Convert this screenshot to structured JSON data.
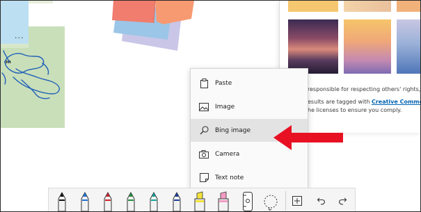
{
  "canvas": {
    "blue_note": {
      "ellipsis": "..."
    },
    "green_note": {
      "partial_text": "on"
    }
  },
  "panel": {
    "legal_line_1": "responsible for respecting others' rights, inc",
    "legal_line_2_prefix": "esults are tagged with ",
    "legal_link": "Creative Commons li",
    "legal_line_3": "he licenses to ensure you comply."
  },
  "context_menu": {
    "items": [
      {
        "label": "Paste",
        "icon": "paste-icon"
      },
      {
        "label": "Image",
        "icon": "image-icon"
      },
      {
        "label": "Bing image",
        "icon": "search-icon",
        "selected": true
      },
      {
        "label": "Camera",
        "icon": "camera-icon"
      },
      {
        "label": "Text note",
        "icon": "text-note-icon"
      }
    ]
  },
  "annotation": {
    "arrow_color": "#e81123"
  },
  "toolbar": {
    "tools": [
      {
        "name": "pen-black",
        "color": "#111111"
      },
      {
        "name": "pen-blue",
        "color": "#1e73d6"
      },
      {
        "name": "pen-red",
        "color": "#d11f2a"
      },
      {
        "name": "pen-green",
        "color": "#1f8f3a"
      },
      {
        "name": "pen-teal",
        "color": "#14a39a"
      },
      {
        "name": "pen-darkblue",
        "color": "#1b3d9a"
      },
      {
        "name": "highlighter-yellow",
        "color": "#f2e23a"
      },
      {
        "name": "highlighter-pink",
        "color": "#f39bc4"
      },
      {
        "name": "ruler",
        "color": "#ffffff"
      },
      {
        "name": "lasso",
        "color": "#ffffff"
      },
      {
        "name": "add",
        "color": "#ffffff"
      },
      {
        "name": "undo",
        "color": "#ffffff"
      },
      {
        "name": "redo",
        "color": "#ffffff"
      }
    ]
  }
}
